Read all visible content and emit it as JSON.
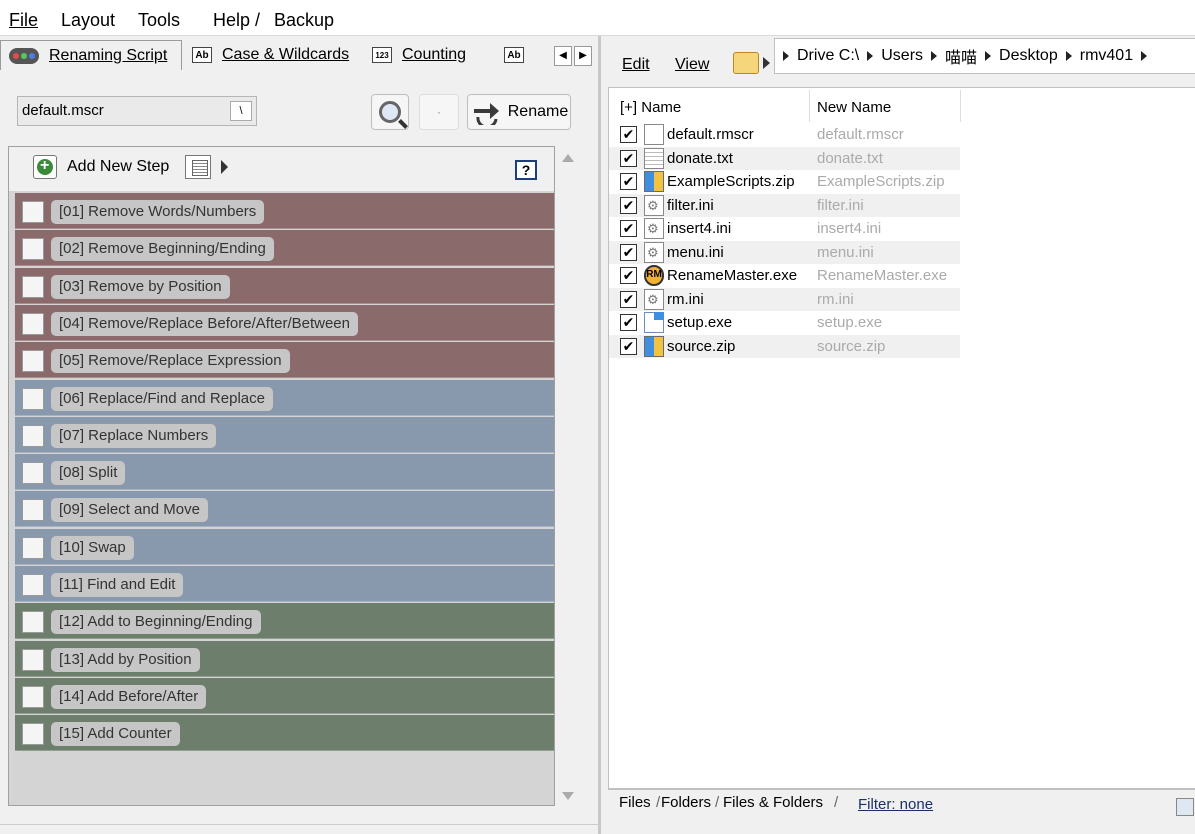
{
  "menu": {
    "file": "File",
    "layout": "Layout",
    "tools": "Tools",
    "help": "Help / ",
    "backup": "Backup"
  },
  "tabs": {
    "renaming_script": "Renaming Script",
    "case_wildcards": "Case & Wildcards",
    "counting": "Counting",
    "icon_ab": "Ab",
    "icon_123": "123"
  },
  "script": {
    "name": "default.mscr",
    "rename_label": "Rename",
    "dot_label": "·"
  },
  "steps_panel": {
    "add_label": "Add New Step",
    "help": "?",
    "steps": [
      {
        "label": "[01]  Remove Words/Numbers",
        "group": "remove"
      },
      {
        "label": "[02]  Remove Beginning/Ending",
        "group": "remove"
      },
      {
        "label": "[03]  Remove by Position",
        "group": "remove"
      },
      {
        "label": "[04]  Remove/Replace Before/After/Between",
        "group": "remove"
      },
      {
        "label": "[05]  Remove/Replace Expression",
        "group": "remove"
      },
      {
        "label": "[06]  Replace/Find and Replace",
        "group": "replace"
      },
      {
        "label": "[07]  Replace Numbers",
        "group": "replace"
      },
      {
        "label": "[08]  Split",
        "group": "replace"
      },
      {
        "label": "[09]  Select and Move",
        "group": "replace"
      },
      {
        "label": "[10]  Swap",
        "group": "replace"
      },
      {
        "label": "[11]  Find and Edit",
        "group": "replace"
      },
      {
        "label": "[12]  Add to Beginning/Ending",
        "group": "add"
      },
      {
        "label": "[13]  Add by Position",
        "group": "add"
      },
      {
        "label": "[14]  Add Before/After",
        "group": "add"
      },
      {
        "label": "[15]  Add Counter",
        "group": "add"
      }
    ]
  },
  "right_toolbar": {
    "edit": "Edit",
    "view": "View"
  },
  "breadcrumb": [
    "Drive C:\\",
    "Users",
    "喵喵",
    "Desktop",
    "rmv401"
  ],
  "file_list": {
    "col_name": "[+] Name",
    "col_new": "New Name",
    "files": [
      {
        "name": "default.rmscr",
        "new": "default.rmscr",
        "icon": "doc"
      },
      {
        "name": "donate.txt",
        "new": "donate.txt",
        "icon": "txt"
      },
      {
        "name": "ExampleScripts.zip",
        "new": "ExampleScripts.zip",
        "icon": "zip"
      },
      {
        "name": "filter.ini",
        "new": "filter.ini",
        "icon": "ini"
      },
      {
        "name": "insert4.ini",
        "new": "insert4.ini",
        "icon": "ini"
      },
      {
        "name": "menu.ini",
        "new": "menu.ini",
        "icon": "ini"
      },
      {
        "name": "RenameMaster.exe",
        "new": "RenameMaster.exe",
        "icon": "rm"
      },
      {
        "name": "rm.ini",
        "new": "rm.ini",
        "icon": "ini"
      },
      {
        "name": "setup.exe",
        "new": "setup.exe",
        "icon": "setup"
      },
      {
        "name": "source.zip",
        "new": "source.zip",
        "icon": "zip"
      }
    ],
    "check_mark": "✔",
    "rm_icon_text": "RM"
  },
  "bottom_tabs": {
    "files": "Files",
    "folders": "Folders",
    "files_folders": "Files & Folders",
    "filter": "Filter:  none"
  },
  "colors": {
    "remove": "#8a6a6a",
    "replace": "#8898ad",
    "add": "#6e7e6c"
  }
}
